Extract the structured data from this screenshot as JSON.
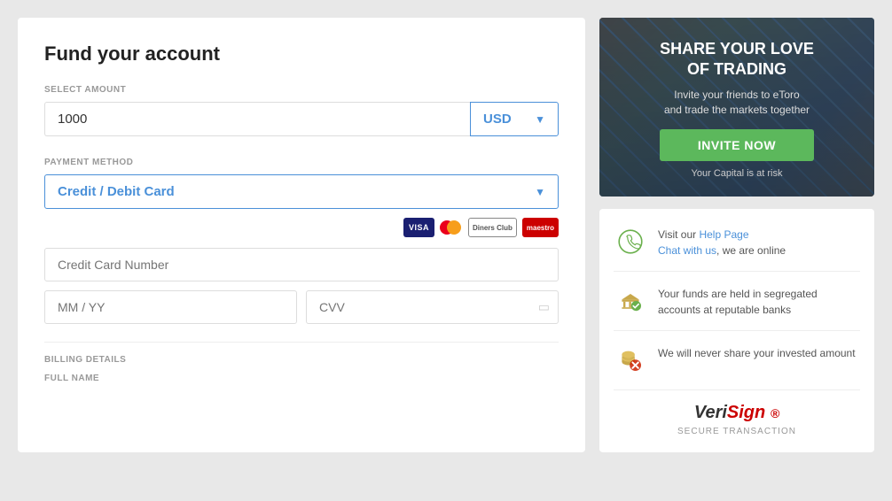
{
  "left": {
    "title": "Fund your account",
    "select_amount_label": "SELECT AMOUNT",
    "amount_value": "1000",
    "currency": "USD",
    "payment_method_label": "PAYMENT METHOD",
    "payment_method_value": "Credit / Debit Card",
    "credit_card_number_placeholder": "Credit Card Number",
    "expiry_placeholder": "MM / YY",
    "cvv_placeholder": "CVV",
    "billing_label": "BILLING DETAILS",
    "fullname_label": "FULL NAME"
  },
  "banner": {
    "title": "SHARE YOUR LOVE\nOF TRADING",
    "subtitle": "Invite your friends to eToro\nand trade the markets together",
    "invite_button": "INVITE NOW",
    "disclaimer": "Your Capital is at risk"
  },
  "info": {
    "row1_link1": "Help Page",
    "row1_link2": "Chat with us",
    "row1_text": ", we are online",
    "row1_prefix": "Visit our ",
    "row2_text": "Your funds are held in segregated accounts at reputable banks",
    "row3_text": "We will never share your invested amount",
    "verisign_label": "VeriSign",
    "secure_label": "SECURE TRANSACTION"
  }
}
